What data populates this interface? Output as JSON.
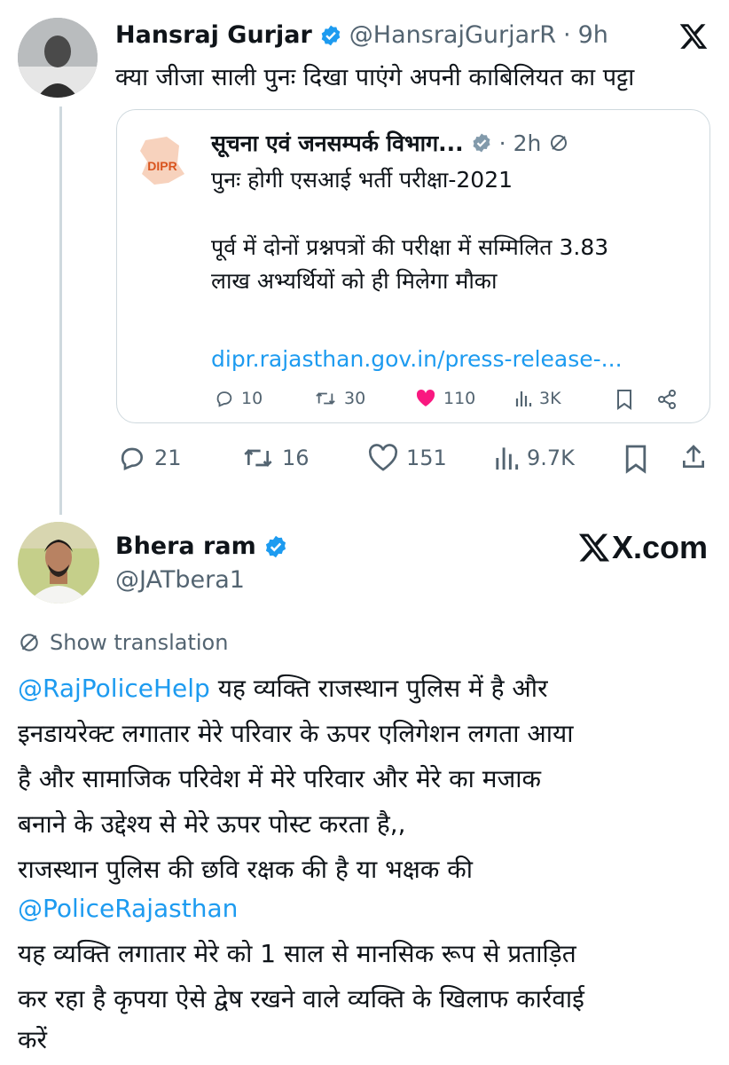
{
  "tweet1": {
    "name": "Hansraj Gurjar",
    "handle": "@HansrajGurjarR",
    "separator": "·",
    "time": "9h",
    "text": "क्या जीजा साली पुनः दिखा पाएंगे अपनी काबिलियत का पट्टा",
    "stats": {
      "replies": "21",
      "reposts": "16",
      "likes": "151",
      "views": "9.7K"
    }
  },
  "quoted": {
    "logo_text": "DIPR",
    "name": "सूचना एवं जनसम्पर्क विभाग...",
    "separator": "·",
    "time": "2h",
    "line1": "पुनः होगी एसआई भर्ती परीक्षा-2021",
    "line2": "पूर्व में दोनों प्रश्नपत्रों की परीक्षा में सम्मिलित 3.83",
    "line3": "लाख अभ्यर्थियों को ही मिलेगा मौका",
    "link": "dipr.rajasthan.gov.in/press-release-...",
    "stats": {
      "replies": "10",
      "reposts": "30",
      "likes": "110",
      "views": "3K"
    }
  },
  "tweet2": {
    "name": "Bhera ram",
    "handle": "@JATbera1",
    "brand": "X.com",
    "show_translation": "Show translation",
    "lines": [
      {
        "mention": "@RajPoliceHelp",
        "text": " यह व्यक्ति राजस्थान पुलिस में है और"
      },
      {
        "mention": "",
        "text": "इनडायरेक्ट लगातार मेरे परिवार के ऊपर एलिगेशन लगता आया"
      },
      {
        "mention": "",
        "text": "है और सामाजिक परिवेश में मेरे परिवार और मेरे का मजाक"
      },
      {
        "mention": "",
        "text": "बनाने के उद्देश्य से मेरे ऊपर पोस्ट करता है,,"
      },
      {
        "mention": "",
        "text": "राजस्थान पुलिस की छवि रक्षक की है या भक्षक की"
      },
      {
        "mention": "@PoliceRajasthan",
        "text": ""
      },
      {
        "mention": "",
        "text": "यह व्यक्ति लगातार मेरे को 1 साल से मानसिक रूप से प्रताड़ित"
      },
      {
        "mention": "",
        "text": "कर रहा है कृपया ऐसे द्वेष रखने वाले व्यक्ति के खिलाफ कार्रवाई"
      },
      {
        "mention": "",
        "text": "करें"
      }
    ]
  },
  "colors": {
    "link": "#1d9bf0",
    "verified": "#1d9bf0",
    "like": "#f91880",
    "muted": "#536471"
  },
  "icons": [
    "x-logo-icon",
    "verified-badge-icon",
    "reply-icon",
    "repost-icon",
    "heart-icon",
    "views-icon",
    "bookmark-icon",
    "share-icon",
    "translate-icon"
  ]
}
